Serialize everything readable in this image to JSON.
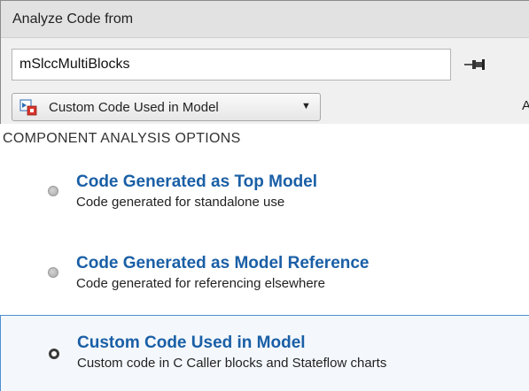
{
  "header": {
    "title": "Analyze Code from"
  },
  "model_input": {
    "value": "mSlccMultiBlocks"
  },
  "dropdown": {
    "selected": "Custom Code Used in Model"
  },
  "clipped_text": "A",
  "options_section": {
    "title": "COMPONENT ANALYSIS OPTIONS",
    "options": [
      {
        "title": "Code Generated as Top Model",
        "description": "Code generated for standalone use",
        "selected": false
      },
      {
        "title": "Code Generated as Model Reference",
        "description": "Code generated for referencing elsewhere",
        "selected": false
      },
      {
        "title": "Custom Code Used in Model",
        "description": "Custom code in C Caller blocks and Stateflow charts",
        "selected": true
      }
    ]
  },
  "colors": {
    "link_blue": "#1a5fa6",
    "selection_border": "#4d8fcf",
    "panel_bg": "#f0f0f0",
    "header_bg": "#e2e2e2"
  },
  "icons": {
    "pin": "pin-icon",
    "model_type": "custom-code-model-icon",
    "caret": "chevron-down-icon"
  }
}
